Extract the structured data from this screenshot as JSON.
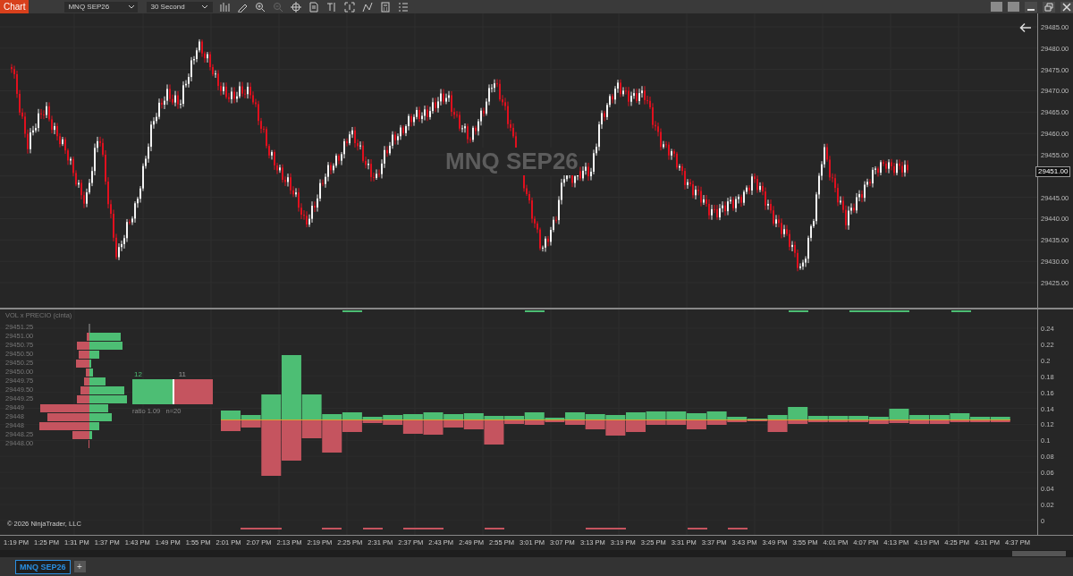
{
  "window": {
    "title": "Chart",
    "instrument": "MNQ SEP26",
    "interval": "30 Second"
  },
  "price_panel": {
    "watermark": "MNQ SEP26",
    "axis_ticks": [
      "29485.00",
      "29480.00",
      "29475.00",
      "29470.00",
      "29465.00",
      "29460.00",
      "29455.00",
      "29445.00",
      "29440.00",
      "29435.00",
      "29430.00",
      "29425.00"
    ],
    "current_price": "29451.00"
  },
  "indicator_panel": {
    "title": "VOL x PRECIO (cinta)",
    "profile_prices": [
      "29451.25",
      "29451.00",
      "29450.75",
      "29450.50",
      "29450.25",
      "29450.00",
      "29449.75",
      "29449.50",
      "29449.25",
      "29449",
      "29448",
      "29448",
      "29448.25",
      "29448.00"
    ],
    "balance": {
      "buy_count": "12",
      "sell_count": "11",
      "level": 0.52,
      "caption": "ratio 1.09   n=20"
    },
    "axis_ticks": [
      "0.24",
      "0.22",
      "0.2",
      "0.18",
      "0.16",
      "0.14",
      "0.12",
      "0.1",
      "0.08",
      "0.06",
      "0.04",
      "0.02",
      "0"
    ],
    "copyright": "© 2026 NinjaTrader, LLC"
  },
  "time_axis": [
    "1:19 PM",
    "1:25 PM",
    "1:31 PM",
    "1:37 PM",
    "1:43 PM",
    "1:49 PM",
    "1:55 PM",
    "2:01 PM",
    "2:07 PM",
    "2:13 PM",
    "2:19 PM",
    "2:25 PM",
    "2:31 PM",
    "2:37 PM",
    "2:43 PM",
    "2:49 PM",
    "2:55 PM",
    "3:01 PM",
    "3:07 PM",
    "3:13 PM",
    "3:19 PM",
    "3:25 PM",
    "3:31 PM",
    "3:37 PM",
    "3:43 PM",
    "3:49 PM",
    "3:55 PM",
    "4:01 PM",
    "4:07 PM",
    "4:13 PM",
    "4:19 PM",
    "4:25 PM",
    "4:31 PM",
    "4:37 PM"
  ],
  "tabs": [
    {
      "label": "MNQ SEP26",
      "selected": true
    }
  ],
  "add_tab": "+"
}
